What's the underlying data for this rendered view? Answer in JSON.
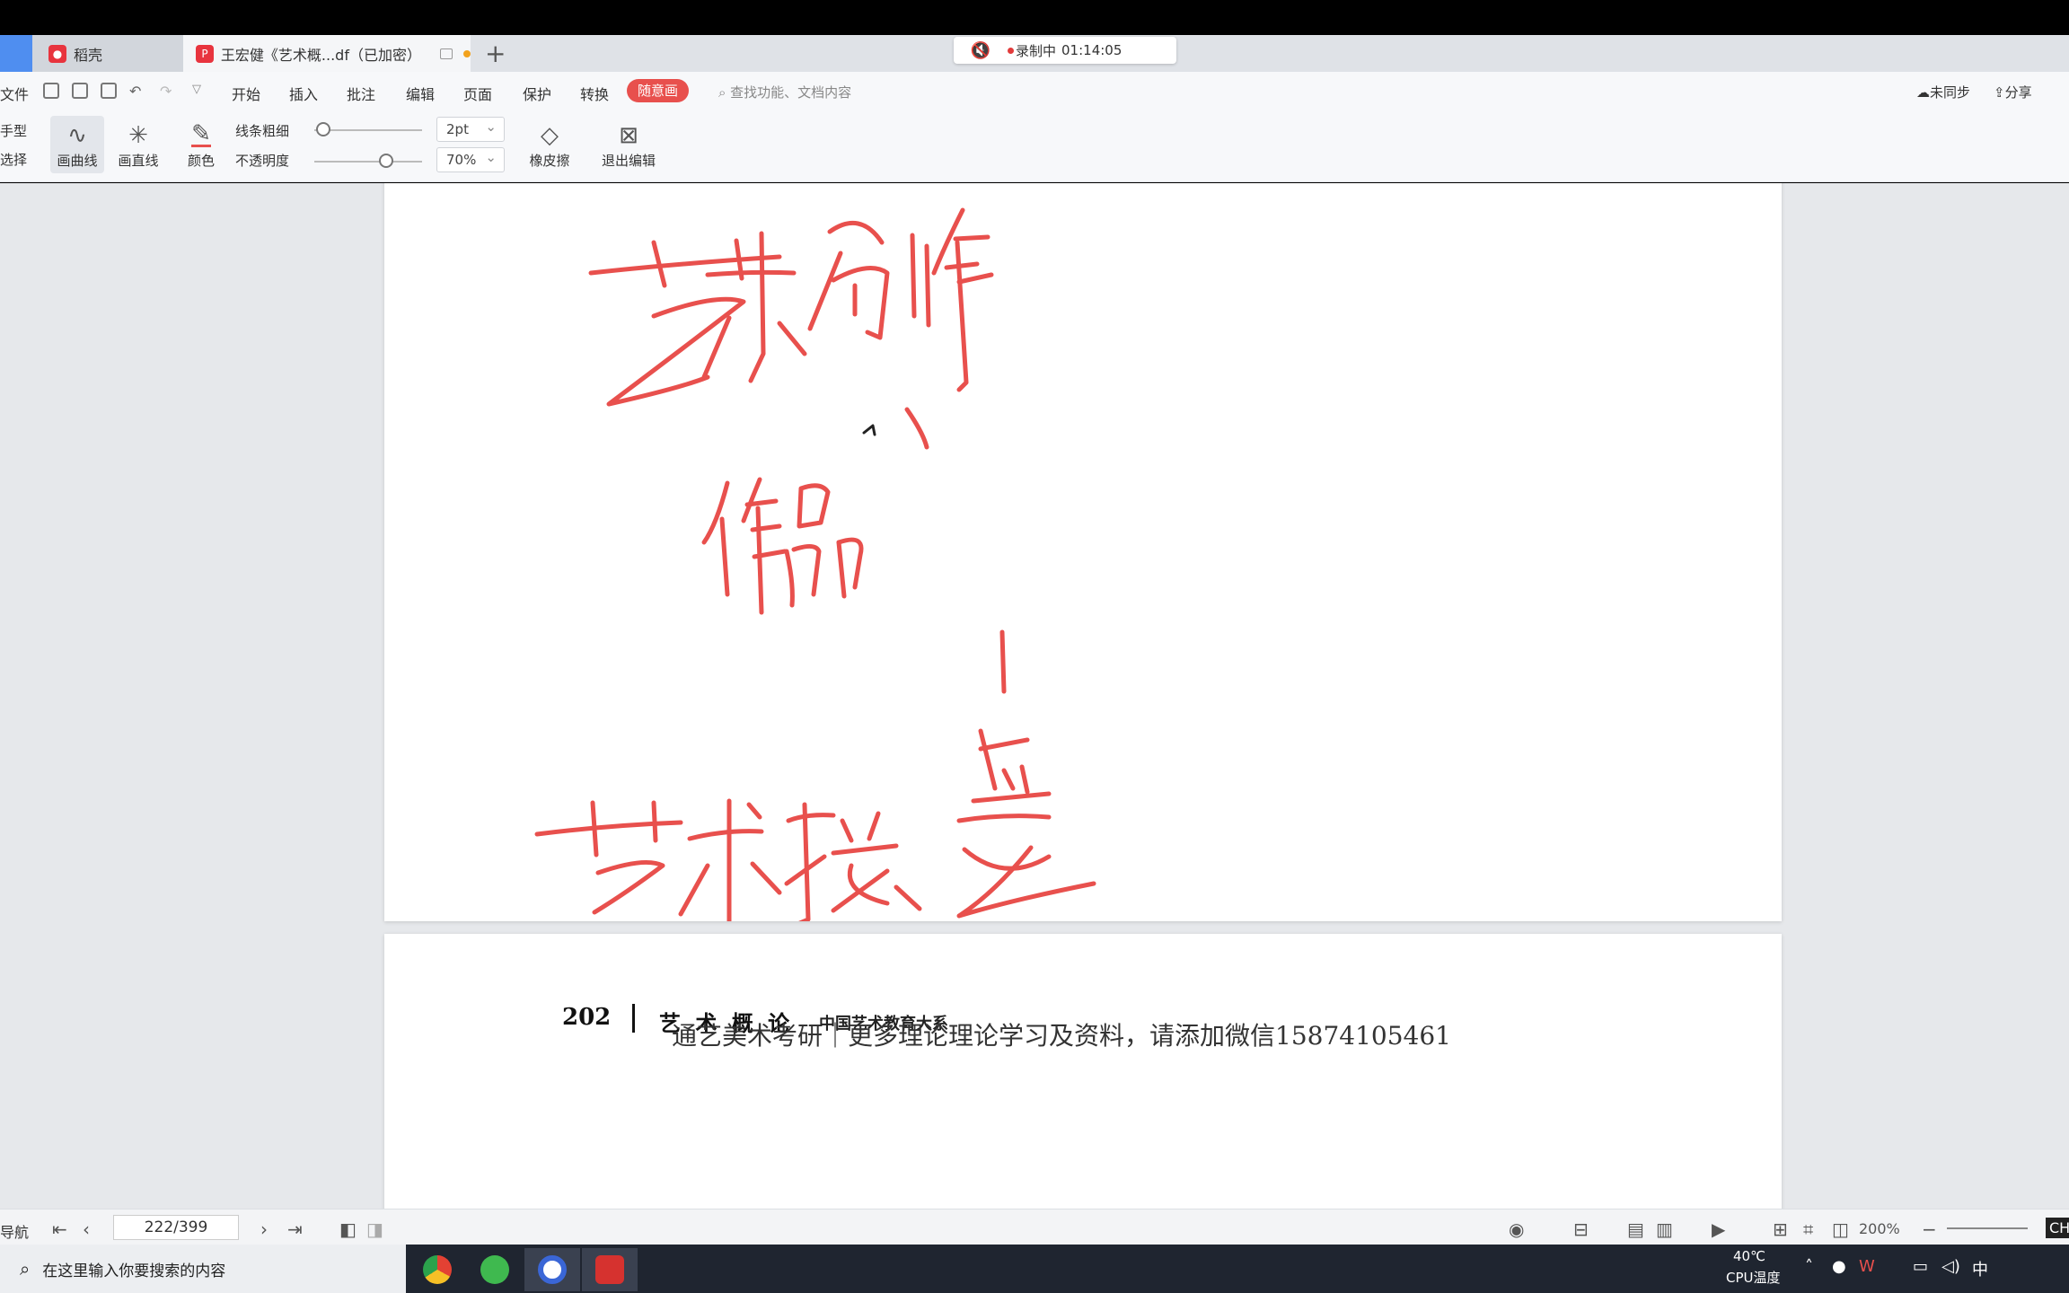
{
  "tabs": [
    {
      "label": "稻壳"
    },
    {
      "label": "王宏健《艺术概...df（已加密）"
    }
  ],
  "recording": {
    "status": "录制中",
    "time": "01:14:05"
  },
  "menu": {
    "file": "文件",
    "items": [
      "开始",
      "插入",
      "批注",
      "编辑",
      "页面",
      "保护",
      "转换"
    ],
    "active": "随意画",
    "search_placeholder": "查找功能、文档内容",
    "sync": "未同步",
    "share": "分享"
  },
  "ink_toolbar": {
    "hand": "手型",
    "select": "选择",
    "curve": "画曲线",
    "line": "画直线",
    "color": "颜色",
    "thickness_label": "线条粗细",
    "thickness_value": "2pt",
    "opacity_label": "不透明度",
    "opacity_value": "70%",
    "eraser": "橡皮擦",
    "exit": "退出编辑"
  },
  "page_footer": {
    "page_number": "202",
    "book_title": "艺 术 概 论",
    "series": "中国艺术教育大系",
    "watermark": "通艺美术考研｜更多理论理论学习及资料，请添加微信15874105461"
  },
  "status": {
    "left_label": "导航",
    "page": "222/399",
    "zoom": "200%"
  },
  "taskbar": {
    "search_placeholder": "在这里输入你要搜索的内容",
    "temp": "40℃",
    "temp_label": "CPU温度",
    "ime": "中",
    "lang": "CH"
  },
  "ink_color": "#e8504d"
}
